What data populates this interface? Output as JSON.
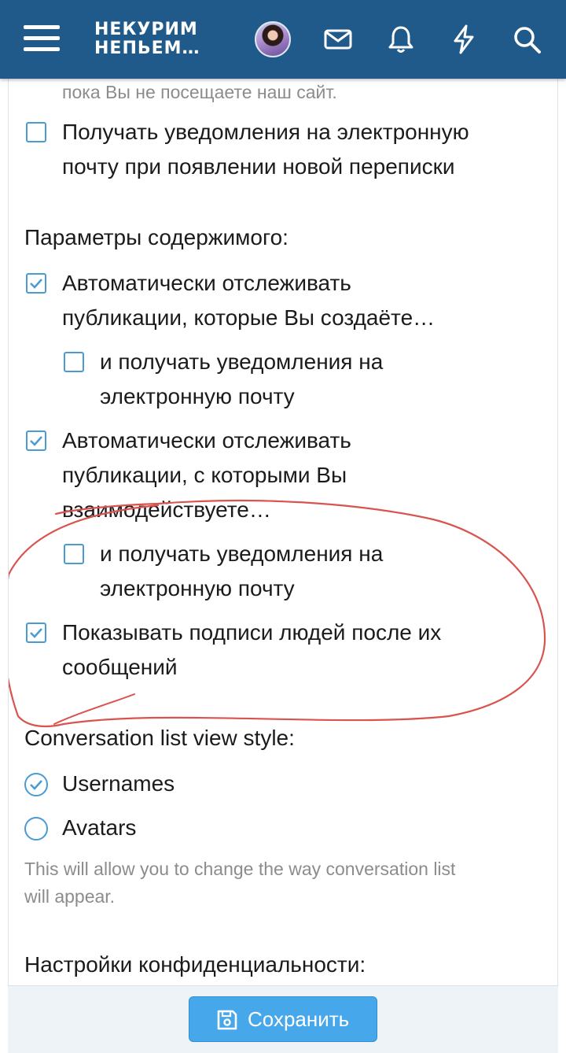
{
  "header": {
    "logo_line1": "НЕКУРИМ",
    "logo_line2": "НЕПЬЕМ…",
    "icons": [
      "menu-icon",
      "avatar",
      "mail-icon",
      "bell-icon",
      "lightning-icon",
      "search-icon"
    ],
    "color": "#1f5a8a"
  },
  "content": {
    "top_hint": "пока Вы не посещаете наш сайт.",
    "email_on_conversation": {
      "line1": "Получать уведомления на электронную",
      "line2": "почту при появлении новой переписки",
      "checked": false
    },
    "content_params_label": "Параметры содержимого:",
    "watch_created": {
      "line1": "Автоматически отслеживать",
      "line2": "публикации, которые Вы создаёте…",
      "checked": true
    },
    "watch_created_email": {
      "line1": "и получать уведомления на",
      "line2": "электронную почту",
      "checked": false
    },
    "watch_interacted": {
      "line1": "Автоматически отслеживать",
      "line2": "публикации, с которыми Вы",
      "line3": "взаимодействуете…",
      "checked": true
    },
    "watch_interacted_email": {
      "line1": "и получать уведомления на",
      "line2": "электронную почту",
      "checked": false
    },
    "show_signatures": {
      "line1": "Показывать подписи людей после их",
      "line2": "сообщений",
      "checked": true
    },
    "list_style_label": "Conversation list view style:",
    "list_style_options": [
      {
        "label": "Usernames",
        "selected": true
      },
      {
        "label": "Avatars",
        "selected": false
      }
    ],
    "list_style_hint_line1": "This will allow you to change the way conversation list",
    "list_style_hint_line2": "will appear.",
    "privacy_label": "Настройки конфиденциальности:"
  },
  "footer": {
    "save_label": "Сохранить",
    "save_icon": "floppy-disk-icon"
  },
  "colors": {
    "accent": "#4a9bd4",
    "button": "#47a7eb",
    "annotation": "#d9534f"
  }
}
